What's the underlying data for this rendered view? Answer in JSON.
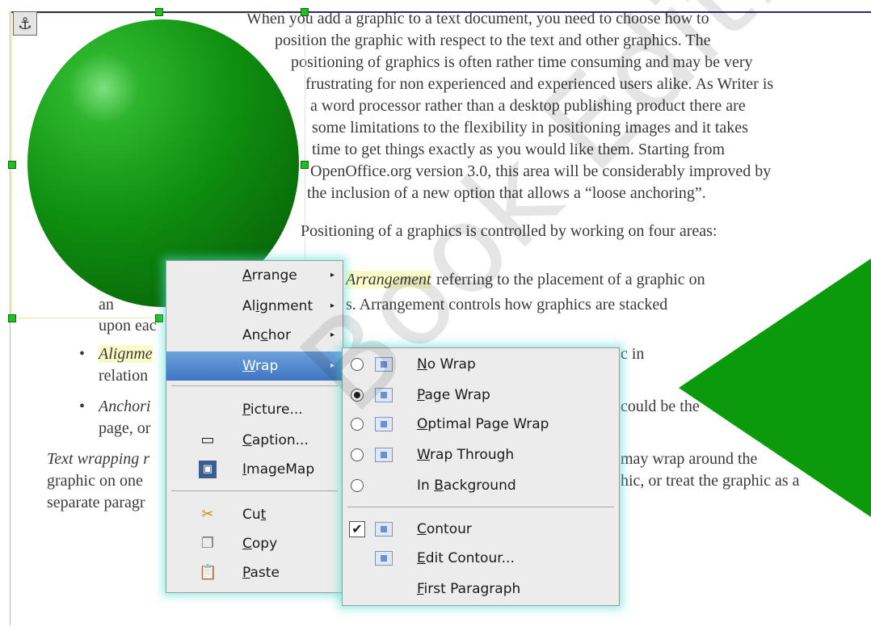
{
  "document": {
    "lines": [
      "When you add a graphic to a text document, you need to choose how to",
      "position the graphic with respect to the text and other graphics. The",
      "positioning of graphics is often rather time consuming and may be very",
      "frustrating for non experienced and experienced users alike. As Writer is",
      "a word processor rather than a desktop publishing product there are",
      "some limitations to the flexibility in positioning images and it takes",
      "time to get things exactly as you would like them. Starting from",
      "OpenOffice.org version 3.0, this area will be considerably improved by",
      "the inclusion of a new option that allows a “loose anchoring”.",
      "Positioning of a graphics is controlled by working on four areas:"
    ],
    "arrangement_em": "Arrangement",
    "arrangement_rest": " referring to the placement of a graphic on",
    "frag_an": "an",
    "frag_stacked": "s. Arrangement controls how graphics are stacked",
    "frag_upon": "upon eac",
    "frag_alignment": "Alignme",
    "frag_in": "c in",
    "frag_relation": "relation",
    "frag_anchoring": "Anchori",
    "frag_could": "could be the",
    "frag_page": "page, or",
    "frag_wrapping": "Text wrapping r",
    "frag_may": "may wrap around the",
    "frag_graphic": "graphic on one",
    "frag_hic": "hic, or treat the graphic as a",
    "frag_separate": "separate paragr"
  },
  "context_menu": {
    "items": [
      {
        "label": "Arrange",
        "mnemonic": "A",
        "rest": "rrange",
        "submenu": true
      },
      {
        "label": "Alignment",
        "pre": "Al",
        "mnemonic": "i",
        "rest": "gnment",
        "submenu": true
      },
      {
        "label": "Anchor",
        "pre": "An",
        "mnemonic": "c",
        "rest": "hor",
        "submenu": true
      },
      {
        "label": "Wrap",
        "mnemonic": "W",
        "rest": "rap",
        "submenu": true,
        "active": true
      },
      {
        "label": "Picture...",
        "mnemonic": "P",
        "rest": "icture..."
      },
      {
        "label": "Caption...",
        "mnemonic": "C",
        "rest": "aption...",
        "icon": "caption-icon"
      },
      {
        "label": "ImageMap",
        "mnemonic": "I",
        "rest": "mageMap",
        "icon": "imagemap-icon"
      },
      {
        "label": "Cut",
        "pre": "Cu",
        "mnemonic": "t",
        "rest": "",
        "icon": "scissors-icon"
      },
      {
        "label": "Copy",
        "mnemonic": "C",
        "rest": "opy",
        "icon": "copy-icon"
      },
      {
        "label": "Paste",
        "mnemonic": "P",
        "rest": "aste",
        "icon": "paste-icon"
      }
    ]
  },
  "wrap_submenu": {
    "items": [
      {
        "label": "No Wrap",
        "mnemonic": "N",
        "rest": "o Wrap",
        "control": "radio",
        "selected": false
      },
      {
        "label": "Page Wrap",
        "mnemonic": "P",
        "rest": "age Wrap",
        "control": "radio",
        "selected": true
      },
      {
        "label": "Optimal Page Wrap",
        "mnemonic": "O",
        "rest": "ptimal Page Wrap",
        "control": "radio",
        "selected": false
      },
      {
        "label": "Wrap Through",
        "mnemonic": "W",
        "rest": "rap Through",
        "control": "radio",
        "selected": false
      },
      {
        "label": "In Background",
        "pre": "In ",
        "mnemonic": "B",
        "rest": "ackground",
        "control": "radio",
        "selected": false
      },
      {
        "label": "Contour",
        "mnemonic": "C",
        "rest": "ontour",
        "control": "checkbox",
        "checked": true
      },
      {
        "label": "Edit Contour...",
        "mnemonic": "E",
        "rest": "dit Contour..."
      },
      {
        "label": "First Paragraph",
        "mnemonic": "F",
        "rest": "irst Paragraph"
      }
    ]
  },
  "watermark": "Book Edition",
  "colors": {
    "green_shape": "#0b9a0b",
    "menu_highlight": "#4a7fc8",
    "menu_glow": "#50dcd2"
  }
}
